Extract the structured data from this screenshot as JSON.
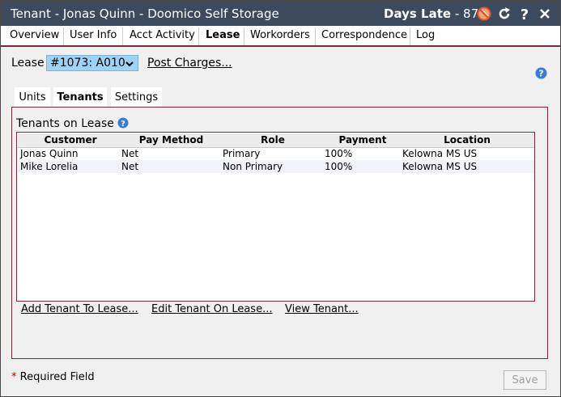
{
  "window": {
    "title": "Tenant - Jonas Quinn - Doomico Self Storage",
    "days_late_label": "Days Late",
    "days_late_value": "- 87",
    "icons": [
      "no-symbol-icon",
      "refresh-icon",
      "help-icon"
    ]
  },
  "tabs": [
    {
      "label": "Overview"
    },
    {
      "label": "User Info"
    },
    {
      "label": "Acct Activity"
    },
    {
      "label": "Lease",
      "active": true
    },
    {
      "label": "Workorders"
    },
    {
      "label": "Correspondence"
    },
    {
      "label": "Log"
    }
  ],
  "lease": {
    "label": "Lease",
    "selected": "#1073: A010",
    "post_charges": "Post Charges..."
  },
  "subtabs": [
    {
      "label": "Units"
    },
    {
      "label": "Tenants",
      "active": true
    },
    {
      "label": "Settings"
    }
  ],
  "tenants": {
    "title": "Tenants on Lease",
    "columns": [
      "Customer",
      "Pay Method",
      "Role",
      "Payment",
      "Location"
    ],
    "rows": [
      [
        "Jonas Quinn",
        "Net",
        "Primary",
        "100%",
        "Kelowna MS US"
      ],
      [
        "Mike Lorelia",
        "Net",
        "Non Primary",
        "100%",
        "Kelowna MS US"
      ]
    ]
  },
  "actions": {
    "add": "Add Tenant To Lease...",
    "edit": "Edit Tenant On Lease...",
    "view": "View Tenant..."
  },
  "footer": {
    "required_star": "*",
    "required_text": "Required Field",
    "save": "Save"
  },
  "colors": {
    "titlebar": "#3c4a5e",
    "accent_border": "#7a2a3a",
    "select_bg": "#9ed3f5",
    "help_blue": "#3a7bd5"
  }
}
